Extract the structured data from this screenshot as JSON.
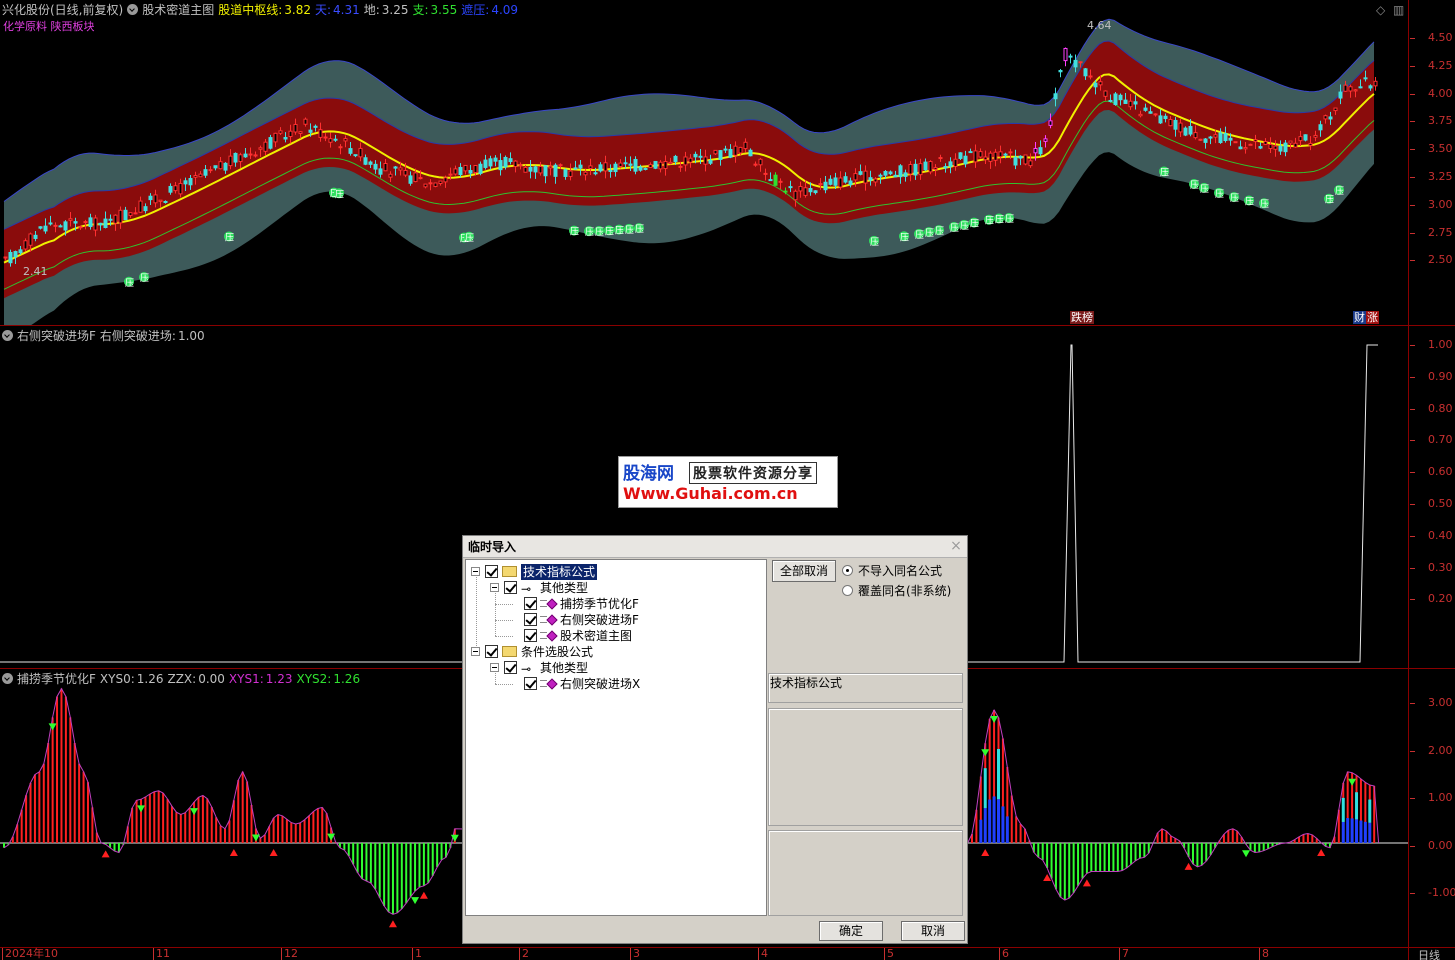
{
  "main_chart": {
    "stock": "兴化股份(日线,前复权)",
    "indicator": "股术密道主图",
    "items": [
      {
        "label": "股道中枢线:",
        "value": "3.82",
        "color": "#f0f000"
      },
      {
        "label": "天:",
        "value": "4.31",
        "color": "#3a4cff"
      },
      {
        "label": "地:",
        "value": "3.25",
        "color": "#c0c0c0"
      },
      {
        "label": "支:",
        "value": "3.55",
        "color": "#30e030"
      },
      {
        "label": "遮压:",
        "value": "4.09",
        "color": "#2b45ff"
      }
    ],
    "sectors": "化学原料 陕西板块",
    "high_label": "4.64",
    "low_label": "2.41",
    "yticks": [
      "4.50",
      "4.25",
      "4.00",
      "3.75",
      "3.50",
      "3.25",
      "3.00",
      "2.75",
      "2.50"
    ],
    "ya_label": "压",
    "tag_die": "跌榜",
    "tag_cai": "财",
    "tag_zhang": "涨"
  },
  "panel2": {
    "name": "右侧突破进场F",
    "line_label": "右侧突破进场:",
    "line_value": "1.00",
    "yticks": [
      "1.00",
      "0.90",
      "0.80",
      "0.70",
      "0.60",
      "0.50",
      "0.40",
      "0.30",
      "0.20"
    ]
  },
  "panel3": {
    "name": "捕捞季节优化F",
    "items": [
      {
        "label": "XYS0:",
        "value": "1.26",
        "color": "#c0c0c0"
      },
      {
        "label": "ZZX:",
        "value": "0.00",
        "color": "#c0c0c0"
      },
      {
        "label": "XYS1:",
        "value": "1.23",
        "color": "#d030d0"
      },
      {
        "label": "XYS2:",
        "value": "1.26",
        "color": "#30e030"
      }
    ],
    "yticks": [
      "3.00",
      "2.00",
      "1.00",
      "0.00",
      "-1.00"
    ]
  },
  "xaxis": {
    "labels": [
      "2024年10",
      "11",
      "12",
      "1",
      "2",
      "3",
      "4",
      "5",
      "6",
      "7",
      "8"
    ],
    "period": "日线"
  },
  "watermark": {
    "line1": "股海网",
    "line1b": "股票软件资源分享",
    "line2": "Www.Guhai.com.cn"
  },
  "dialog": {
    "title": "临时导入",
    "close": "×",
    "tree": {
      "group1": "技术指标公式",
      "group1_sub": "其他类型",
      "group1_items": [
        "捕捞季节优化F",
        "右侧突破进场F",
        "股术密道主图"
      ],
      "group2": "条件选股公式",
      "group2_sub": "其他类型",
      "group2_items": [
        "右侧突破进场X"
      ]
    },
    "cancel_all": "全部取消",
    "radio1": "不导入同名公式",
    "radio2": "覆盖同名(非系统)",
    "info_label": "技术指标公式",
    "ok": "确定",
    "cancel": "取消"
  }
}
